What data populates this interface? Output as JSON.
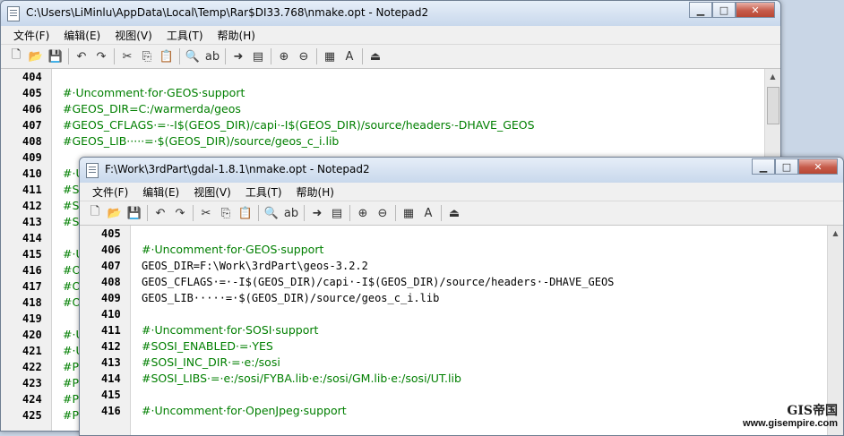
{
  "window1": {
    "title": "C:\\Users\\LiMinlu\\AppData\\Local\\Temp\\Rar$DI33.768\\nmake.opt - Notepad2",
    "menu": [
      "文件(F)",
      "编辑(E)",
      "视图(V)",
      "工具(T)",
      "帮助(H)"
    ],
    "line_numbers": [
      "404",
      "405",
      "406",
      "407",
      "408",
      "409",
      "410",
      "411",
      "412",
      "413",
      "414",
      "415",
      "416",
      "417",
      "418",
      "419",
      "420",
      "421",
      "422",
      "423",
      "424",
      "425"
    ],
    "lines": [
      {
        "text": "",
        "style": "norm"
      },
      {
        "text": "#·Uncomment·for·GEOS·support",
        "style": "cmt"
      },
      {
        "text": "#GEOS_DIR=C:/warmerda/geos",
        "style": "cmt"
      },
      {
        "text": "#GEOS_CFLAGS·=·-I$(GEOS_DIR)/capi·-I$(GEOS_DIR)/source/headers·-DHAVE_GEOS",
        "style": "cmt"
      },
      {
        "text": "#GEOS_LIB·····=·$(GEOS_DIR)/source/geos_c_i.lib",
        "style": "cmt"
      },
      {
        "text": "",
        "style": "norm"
      },
      {
        "text": "#·U",
        "style": "cmt"
      },
      {
        "text": "#S",
        "style": "cmt"
      },
      {
        "text": "#S",
        "style": "cmt"
      },
      {
        "text": "#S",
        "style": "cmt"
      },
      {
        "text": "",
        "style": "norm"
      },
      {
        "text": "#·U",
        "style": "cmt"
      },
      {
        "text": "#O",
        "style": "cmt"
      },
      {
        "text": "#O",
        "style": "cmt"
      },
      {
        "text": "#O",
        "style": "cmt"
      },
      {
        "text": "",
        "style": "norm"
      },
      {
        "text": "#·U",
        "style": "cmt"
      },
      {
        "text": "#·U",
        "style": "cmt"
      },
      {
        "text": "#PC",
        "style": "cmt"
      },
      {
        "text": "#PC",
        "style": "cmt"
      },
      {
        "text": "#PC",
        "style": "cmt"
      },
      {
        "text": "#PC",
        "style": "cmt"
      }
    ]
  },
  "window2": {
    "title": "F:\\Work\\3rdPart\\gdal-1.8.1\\nmake.opt - Notepad2",
    "menu": [
      "文件(F)",
      "编辑(E)",
      "视图(V)",
      "工具(T)",
      "帮助(H)"
    ],
    "line_numbers": [
      "405",
      "406",
      "407",
      "408",
      "409",
      "410",
      "411",
      "412",
      "413",
      "414",
      "415",
      "416"
    ],
    "lines": [
      {
        "text": "",
        "style": "norm"
      },
      {
        "text": "#·Uncomment·for·GEOS·support",
        "style": "cmt"
      },
      {
        "text": "GEOS_DIR=F:\\Work\\3rdPart\\geos-3.2.2",
        "style": "norm"
      },
      {
        "text": "GEOS_CFLAGS·=·-I$(GEOS_DIR)/capi·-I$(GEOS_DIR)/source/headers·-DHAVE_GEOS",
        "style": "norm"
      },
      {
        "text": "GEOS_LIB·····=·$(GEOS_DIR)/source/geos_c_i.lib",
        "style": "norm"
      },
      {
        "text": "",
        "style": "norm"
      },
      {
        "text": "#·Uncomment·for·SOSI·support",
        "style": "cmt"
      },
      {
        "text": "#SOSI_ENABLED·=·YES",
        "style": "cmt"
      },
      {
        "text": "#SOSI_INC_DIR·=·e:/sosi",
        "style": "cmt"
      },
      {
        "text": "#SOSI_LIBS·=·e:/sosi/FYBA.lib·e:/sosi/GM.lib·e:/sosi/UT.lib",
        "style": "cmt"
      },
      {
        "text": "",
        "style": "norm"
      },
      {
        "text": "#·Uncomment·for·OpenJpeg·support",
        "style": "cmt"
      }
    ]
  },
  "toolbar_icons": [
    "new-file-icon",
    "open-folder-icon",
    "save-icon",
    "|",
    "undo-icon",
    "redo-icon",
    "|",
    "cut-icon",
    "copy-icon",
    "paste-icon",
    "|",
    "find-icon",
    "replace-icon",
    "|",
    "goto-icon",
    "properties-icon",
    "|",
    "zoom-in-icon",
    "zoom-out-icon",
    "|",
    "schemes-icon",
    "font-icon",
    "|",
    "exit-icon"
  ],
  "caption_buttons": {
    "minimize": "▁",
    "maximize": "□",
    "close": "✕"
  },
  "watermark": {
    "logo": "GIS帝国",
    "url": "www.gisempire.com"
  },
  "colors": {
    "comment": "#007f00",
    "text": "#000000"
  }
}
